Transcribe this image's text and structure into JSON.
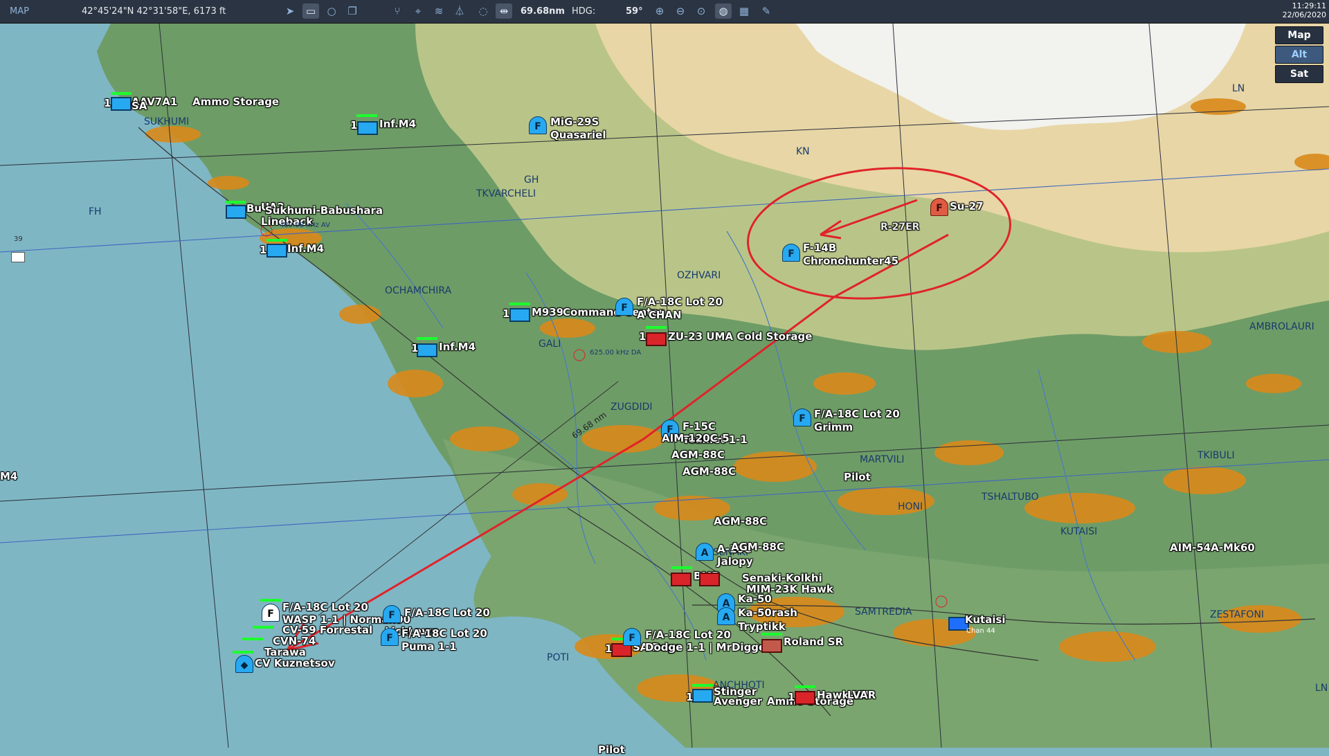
{
  "toolbar": {
    "title": "MAP",
    "cursor_coords": "42°45'24\"N 42°31'58\"E, 6173 ft",
    "distance": "69.68nm",
    "heading_label": "HDG:",
    "heading_value": "59°",
    "left_icons": [
      "navigate-icon",
      "layer-icon",
      "circle-icon",
      "copy-icon"
    ],
    "mid_icons": [
      "route-icon",
      "target-icon",
      "signal-icon",
      "tower-icon",
      "chat-icon",
      "ruler-icon"
    ],
    "right_icons": [
      "zoom-in-icon",
      "zoom-out-icon",
      "zoom-fit-icon",
      "globe-icon",
      "grid-icon",
      "pencil-icon"
    ]
  },
  "clock": {
    "time": "11:29:11",
    "date": "22/06/2020"
  },
  "map_buttons": [
    {
      "label": "Map"
    },
    {
      "label": "Alt",
      "selected": true
    },
    {
      "label": "Sat"
    }
  ],
  "colors": {
    "sea": "#7fb6c4",
    "lowland": "#6e9c67",
    "foothills": "#bfc98a",
    "highland": "#e8d6a6",
    "snow": "#f2f2ee",
    "urban": "#d98a1a",
    "friendly": "#27a9f2",
    "hostile": "#e05a44",
    "annotation": "#e0232a",
    "health": "#1bff2e"
  },
  "towns": [
    "SUKHUMI",
    "TKVARCHELI",
    "GH",
    "KN",
    "LN",
    "FH",
    "OCHAMCHIRA",
    "OZHVARI",
    "GALI",
    "ZUGDIDI",
    "MARTVILI",
    "HONI",
    "TSHALTUBO",
    "TKIBULI",
    "AMBROLAURI",
    "KUTAISI",
    "SAMTREDIA",
    "SENAKI",
    "POTI",
    "ANCHHOTI",
    "ZESTAFONI",
    "LN"
  ],
  "unit_labels": [
    "1",
    "AAV7A1",
    "Ammo Storage",
    "SA",
    "1",
    "Inf.M4",
    "MiG-29S",
    "Quasariel",
    "Bu",
    "UA2",
    "Sukhumi-Babushara",
    "Lineback",
    "489.00 kHz AV",
    "1",
    "Inf.M4",
    "Su-27",
    "R-27ER",
    "F-14B",
    "Chronohunter45",
    "1",
    "M939",
    "Command Center",
    "F/A-18C Lot 20",
    "A CHAN",
    "1",
    "ZU-23 UMA Cold Storage",
    "1",
    "Inf.M4",
    "625.00 kHz DA",
    "F-15C",
    "Teamet 1-1",
    "AIM-120C-5",
    "AGM-88C",
    "AGM-88C",
    "F/A-18C Lot 20",
    "Grimm",
    "Pilot",
    "AGM-88C",
    "A-10C",
    "AGM-88C",
    "Jalopy",
    "BMP",
    "Senaki-Kolkhi",
    "MIM-23K Hawk",
    "Ka-50",
    "Ka-50rash",
    "Tryptikk",
    "F/A-18C Lot 20",
    "WASP 1-1 | Norman90",
    "CV-59 Forrestal",
    "LickLawn",
    "CVN-74",
    "Tarawa",
    "CV Kuznetsov",
    "F/A-18C Lot 20",
    "F/A-18C Lot 20",
    "Puma 1-1",
    "1",
    "SA Dogs",
    "F/A-18C Lot 20",
    "Dodge 1-1 | MrDiggens",
    "Roland SR",
    "1",
    "Stinger",
    "Avenger",
    "Ammo Storage",
    "1",
    "Hawk-LN",
    "LVAR",
    "Kutaisi",
    "Chan 44",
    "AIM-54A-Mk60",
    "Pilot",
    "39",
    "M4"
  ],
  "annotations": {
    "heading_tick": "59°",
    "range_text": "69.68 nm"
  }
}
